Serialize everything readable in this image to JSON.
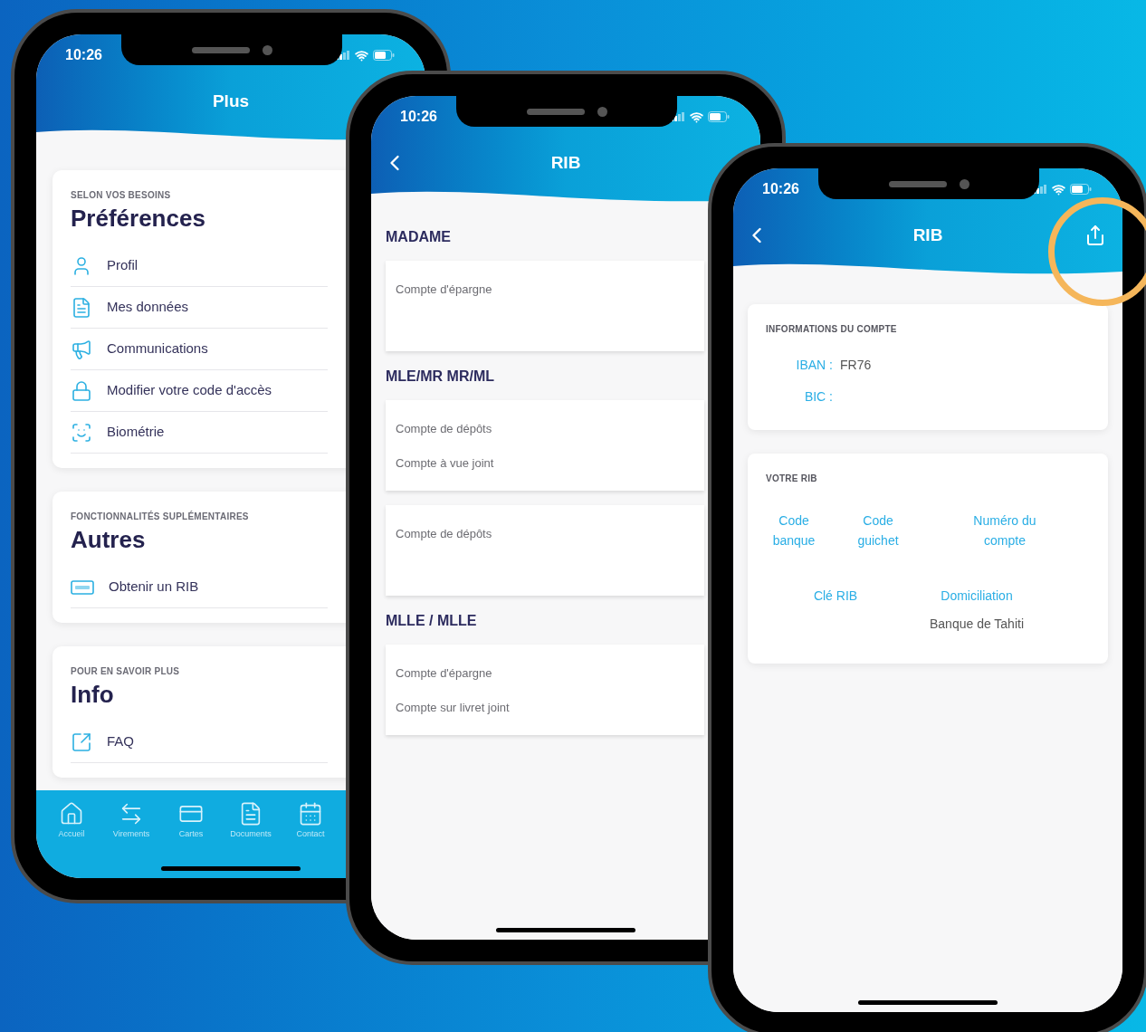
{
  "phones": [
    {
      "kind": "menu",
      "status_time": "10:26",
      "title": "Plus",
      "sections": [
        {
          "overline": "SELON VOS BESOINS",
          "heading": "Préférences",
          "items": [
            "Profil",
            "Mes données",
            "Communications",
            "Modifier votre code d'accès",
            "Biométrie"
          ]
        },
        {
          "overline": "FONCTIONNALITÉS SUPLÉMENTAIRES",
          "heading": "Autres",
          "items": [
            "Obtenir un RIB"
          ]
        },
        {
          "overline": "POUR EN SAVOIR PLUS",
          "heading": "Info",
          "items": [
            "FAQ"
          ]
        }
      ],
      "tab_bar": [
        "Accueil",
        "Virements",
        "Cartes",
        "Documents",
        "Contact"
      ]
    },
    {
      "kind": "accounts",
      "status_time": "10:26",
      "title": "RIB",
      "groups": [
        {
          "heading": "MADAME",
          "cards": [
            [
              "Compte d'épargne"
            ]
          ]
        },
        {
          "heading": "MLE/MR MR/ML",
          "cards": [
            [
              "Compte de dépôts",
              "Compte à vue joint"
            ],
            [
              "Compte de dépôts"
            ]
          ]
        },
        {
          "heading": "MLLE / MLLE",
          "cards": [
            [
              "Compte d'épargne",
              "Compte sur livret joint"
            ]
          ]
        }
      ]
    },
    {
      "kind": "detail",
      "status_time": "10:26",
      "title": "RIB",
      "highlighted_share": true,
      "info": {
        "overline": "INFORMATIONS DU COMPTE",
        "fields": [
          {
            "label": "IBAN :",
            "value": "FR76"
          },
          {
            "label": "BIC :"
          }
        ]
      },
      "rib": {
        "overline": "VOTRE RIB",
        "top": [
          "Code banque",
          "Code guichet",
          "Numéro du compte"
        ],
        "bottom": [
          {
            "label": "Clé RIB"
          },
          {
            "label": "Domiciliation",
            "value": "Banque de Tahiti"
          }
        ]
      }
    }
  ]
}
